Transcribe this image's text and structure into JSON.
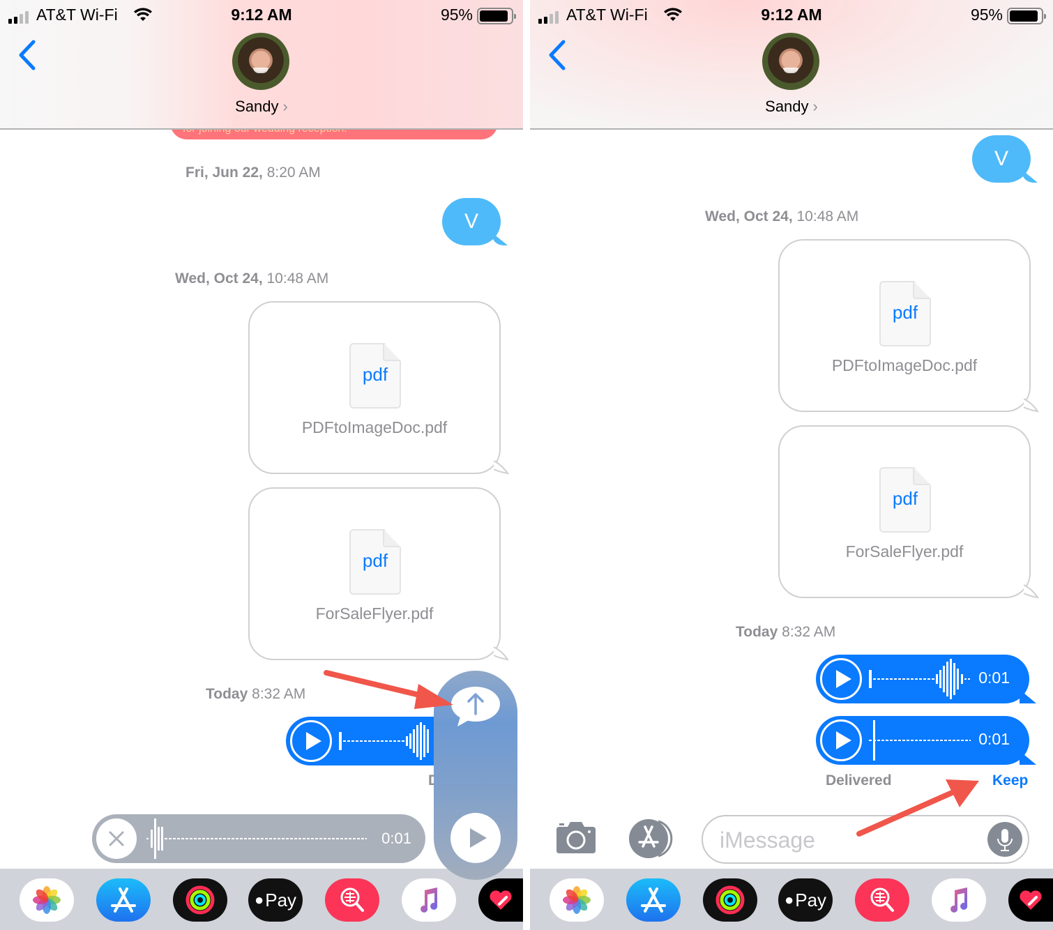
{
  "status_bar": {
    "carrier": "AT&T Wi-Fi",
    "time": "9:12 AM",
    "battery_percent": "95%",
    "battery_level": 0.95,
    "signal_bars": 2
  },
  "header": {
    "contact_name": "Sandy",
    "chevron": "›"
  },
  "left_screen": {
    "partial_message": "for joining our wedding reception.",
    "timestamps": [
      {
        "day": "Fri, Jun 22,",
        "time": "8:20 AM"
      },
      {
        "day": "Wed, Oct 24,",
        "time": "10:48 AM"
      },
      {
        "day": "Today",
        "time": "8:32 AM"
      }
    ],
    "text_bubble": "V",
    "attachments": [
      {
        "icon_label": "pdf",
        "filename": "PDFtoImageDoc.pdf"
      },
      {
        "icon_label": "pdf",
        "filename": "ForSaleFlyer.pdf"
      }
    ],
    "audio_message": {
      "duration": ""
    },
    "status_partial": "D",
    "recording": {
      "duration": "0:01"
    }
  },
  "right_screen": {
    "timestamps": [
      {
        "day": "Wed, Oct 24,",
        "time": "10:48 AM"
      },
      {
        "day": "Today",
        "time": "8:32 AM"
      }
    ],
    "text_bubble": "V",
    "attachments": [
      {
        "icon_label": "pdf",
        "filename": "PDFtoImageDoc.pdf"
      },
      {
        "icon_label": "pdf",
        "filename": "ForSaleFlyer.pdf"
      }
    ],
    "audio_messages": [
      {
        "duration": "0:01"
      },
      {
        "duration": "0:01"
      }
    ],
    "delivery_status": "Delivered",
    "keep_label": "Keep",
    "input": {
      "placeholder": "iMessage",
      "value": ""
    }
  },
  "app_drawer": [
    {
      "name": "Photos",
      "icon": "photos-icon"
    },
    {
      "name": "App Store",
      "icon": "app-store-icon"
    },
    {
      "name": "Activity",
      "icon": "activity-icon"
    },
    {
      "name": "Apple Pay",
      "icon": "apple-pay-icon",
      "label": "Pay"
    },
    {
      "name": "Search",
      "icon": "web-search-icon"
    },
    {
      "name": "Music",
      "icon": "music-icon"
    },
    {
      "name": "Digital Touch",
      "icon": "digital-touch-icon"
    }
  ],
  "colors": {
    "accent_blue": "#0a7aff",
    "sms_bubble": "#4fbaf9",
    "annotation_arrow": "#f0564a",
    "muted_text": "#8e8e93"
  }
}
